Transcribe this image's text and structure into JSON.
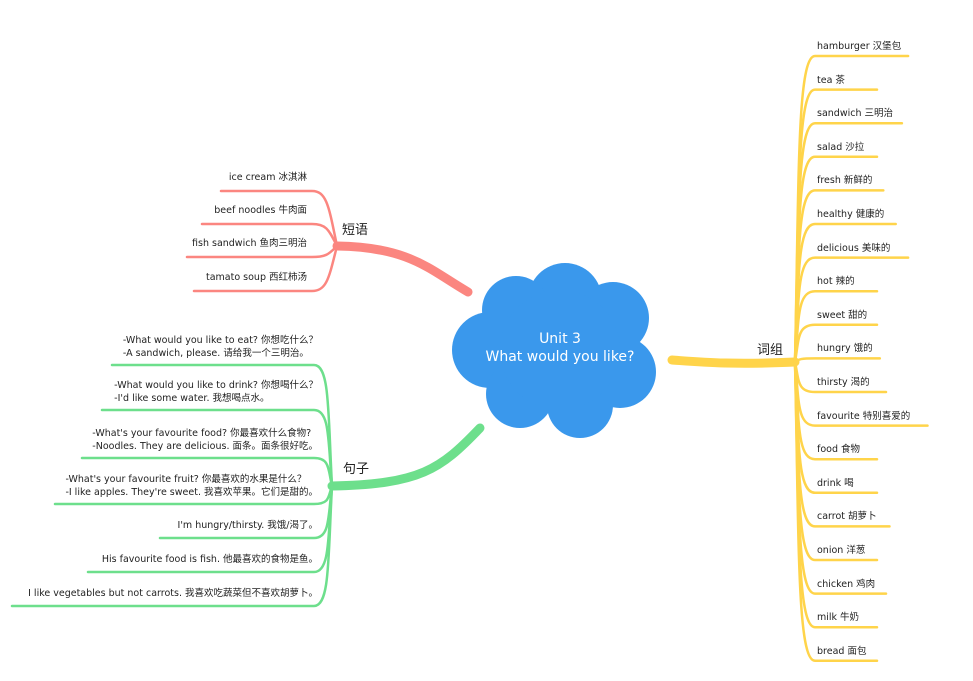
{
  "center": {
    "line1": "Unit 3",
    "line2": "What would you like?",
    "color": "#3a98ec"
  },
  "branches": {
    "phrases": {
      "label": "短语",
      "color": "#fb8680",
      "items": [
        "ice cream 冰淇淋",
        "beef noodles 牛肉面",
        "fish sandwich 鱼肉三明治",
        "tamato soup 西红柿汤"
      ]
    },
    "sentences": {
      "label": "句子",
      "color": "#6ddf8c",
      "items": [
        [
          "-What would you like to eat? 你想吃什么？",
          "-A sandwich, please. 请给我一个三明治。"
        ],
        [
          "-What would you like to drink? 你想喝什么？",
          "-I'd like some water. 我想喝点水。"
        ],
        [
          "-What's your favourite food? 你最喜欢什么食物?",
          "-Noodles. They are delicious. 面条。面条很好吃。"
        ],
        [
          "-What's your favourite fruit? 你最喜欢的水果是什么？",
          "-I like apples. They're sweet. 我喜欢苹果。它们是甜的。"
        ],
        [
          "I'm hungry/thirsty. 我饿/渴了。"
        ],
        [
          "His favourite food is fish. 他最喜欢的食物是鱼。"
        ],
        [
          "I like vegetables but not carrots. 我喜欢吃蔬菜但不喜欢胡萝卜。"
        ]
      ]
    },
    "words": {
      "label": "词组",
      "color": "#ffd44a",
      "items": [
        "hamburger 汉堡包",
        "tea 茶",
        "sandwich 三明治",
        "salad 沙拉",
        "fresh 新鲜的",
        "healthy 健康的",
        "delicious 美味的",
        "hot 辣的",
        "sweet 甜的",
        "hungry 饿的",
        "thirsty 渴的",
        "favourite 特别喜爱的",
        "food 食物",
        "drink 喝",
        "carrot 胡萝卜",
        "onion 洋葱",
        "chicken 鸡肉",
        "milk 牛奶",
        "bread 面包"
      ]
    }
  }
}
